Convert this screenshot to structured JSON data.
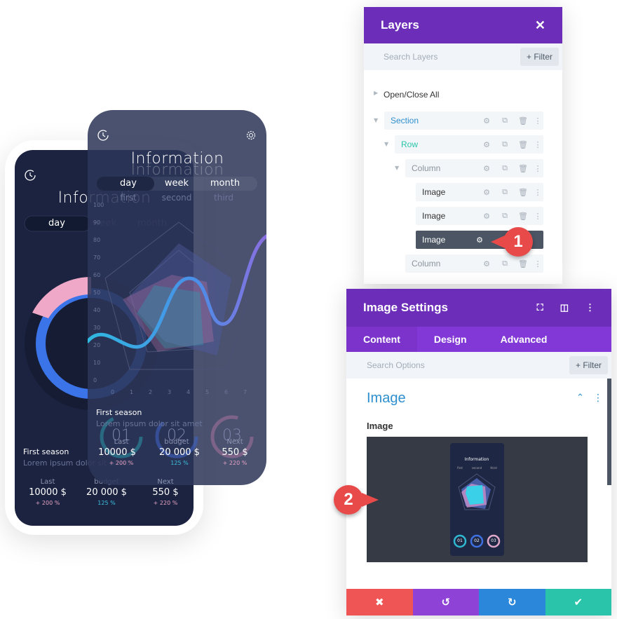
{
  "back_phone": {
    "title": "Information",
    "tabs": [
      "day",
      "week",
      "month"
    ],
    "season_title": "First season",
    "season_text": "Lorem ipsum dolor sit amet",
    "stats": [
      {
        "label": "Last",
        "value": "10000 $",
        "pct": "+ 200 %"
      },
      {
        "label": "budget",
        "value": "20 000 $",
        "pct": "125 %"
      },
      {
        "label": "Next",
        "value": "550 $",
        "pct": "+ 220 %"
      }
    ]
  },
  "front_phone": {
    "title": "Information",
    "tabs": [
      "day",
      "week",
      "month"
    ],
    "subtabs": [
      "first",
      "second",
      "third"
    ],
    "y_ticks": [
      "100",
      "90",
      "80",
      "70",
      "60",
      "50",
      "40",
      "30",
      "20",
      "10",
      "0"
    ],
    "x_ticks": [
      "0",
      "1",
      "2",
      "3",
      "4",
      "5",
      "6",
      "7"
    ],
    "season_title": "First season",
    "season_text": "Lorem ipsum dolor sit amet",
    "rings": [
      "01",
      "02",
      "03"
    ],
    "stats": [
      {
        "label": "Last",
        "value": "10000 $",
        "pct": "+ 200 %"
      },
      {
        "label": "budget",
        "value": "20 000 $",
        "pct": "125 %"
      },
      {
        "label": "Next",
        "value": "550 $",
        "pct": "+ 220 %"
      }
    ]
  },
  "layers": {
    "title": "Layers",
    "search_placeholder": "Search Layers",
    "filter": "+ Filter",
    "open_close": "Open/Close All",
    "items": [
      {
        "label": "Section"
      },
      {
        "label": "Row"
      },
      {
        "label": "Column"
      },
      {
        "label": "Image"
      },
      {
        "label": "Image"
      },
      {
        "label": "Image"
      },
      {
        "label": "Column"
      }
    ]
  },
  "settings": {
    "title": "Image Settings",
    "tabs": [
      "Content",
      "Design",
      "Advanced"
    ],
    "search_placeholder": "Search Options",
    "filter": "+ Filter",
    "section_title": "Image",
    "field_label": "Image",
    "thumb": {
      "title": "Information",
      "tabs": [
        "first",
        "second",
        "third"
      ],
      "rings": [
        "01",
        "02",
        "03"
      ]
    }
  },
  "footer": {
    "cancel": "✖",
    "undo": "↺",
    "redo": "↻",
    "save": "✔"
  },
  "callouts": [
    "1",
    "2"
  ],
  "colors": {
    "purple": "#6c2eb9",
    "tab_purple": "#8138d6",
    "section_blue": "#2e8fce",
    "row_green": "#29c4a9",
    "red": "#ef5555",
    "blue": "#2b87da",
    "teal": "#29c4a9"
  }
}
